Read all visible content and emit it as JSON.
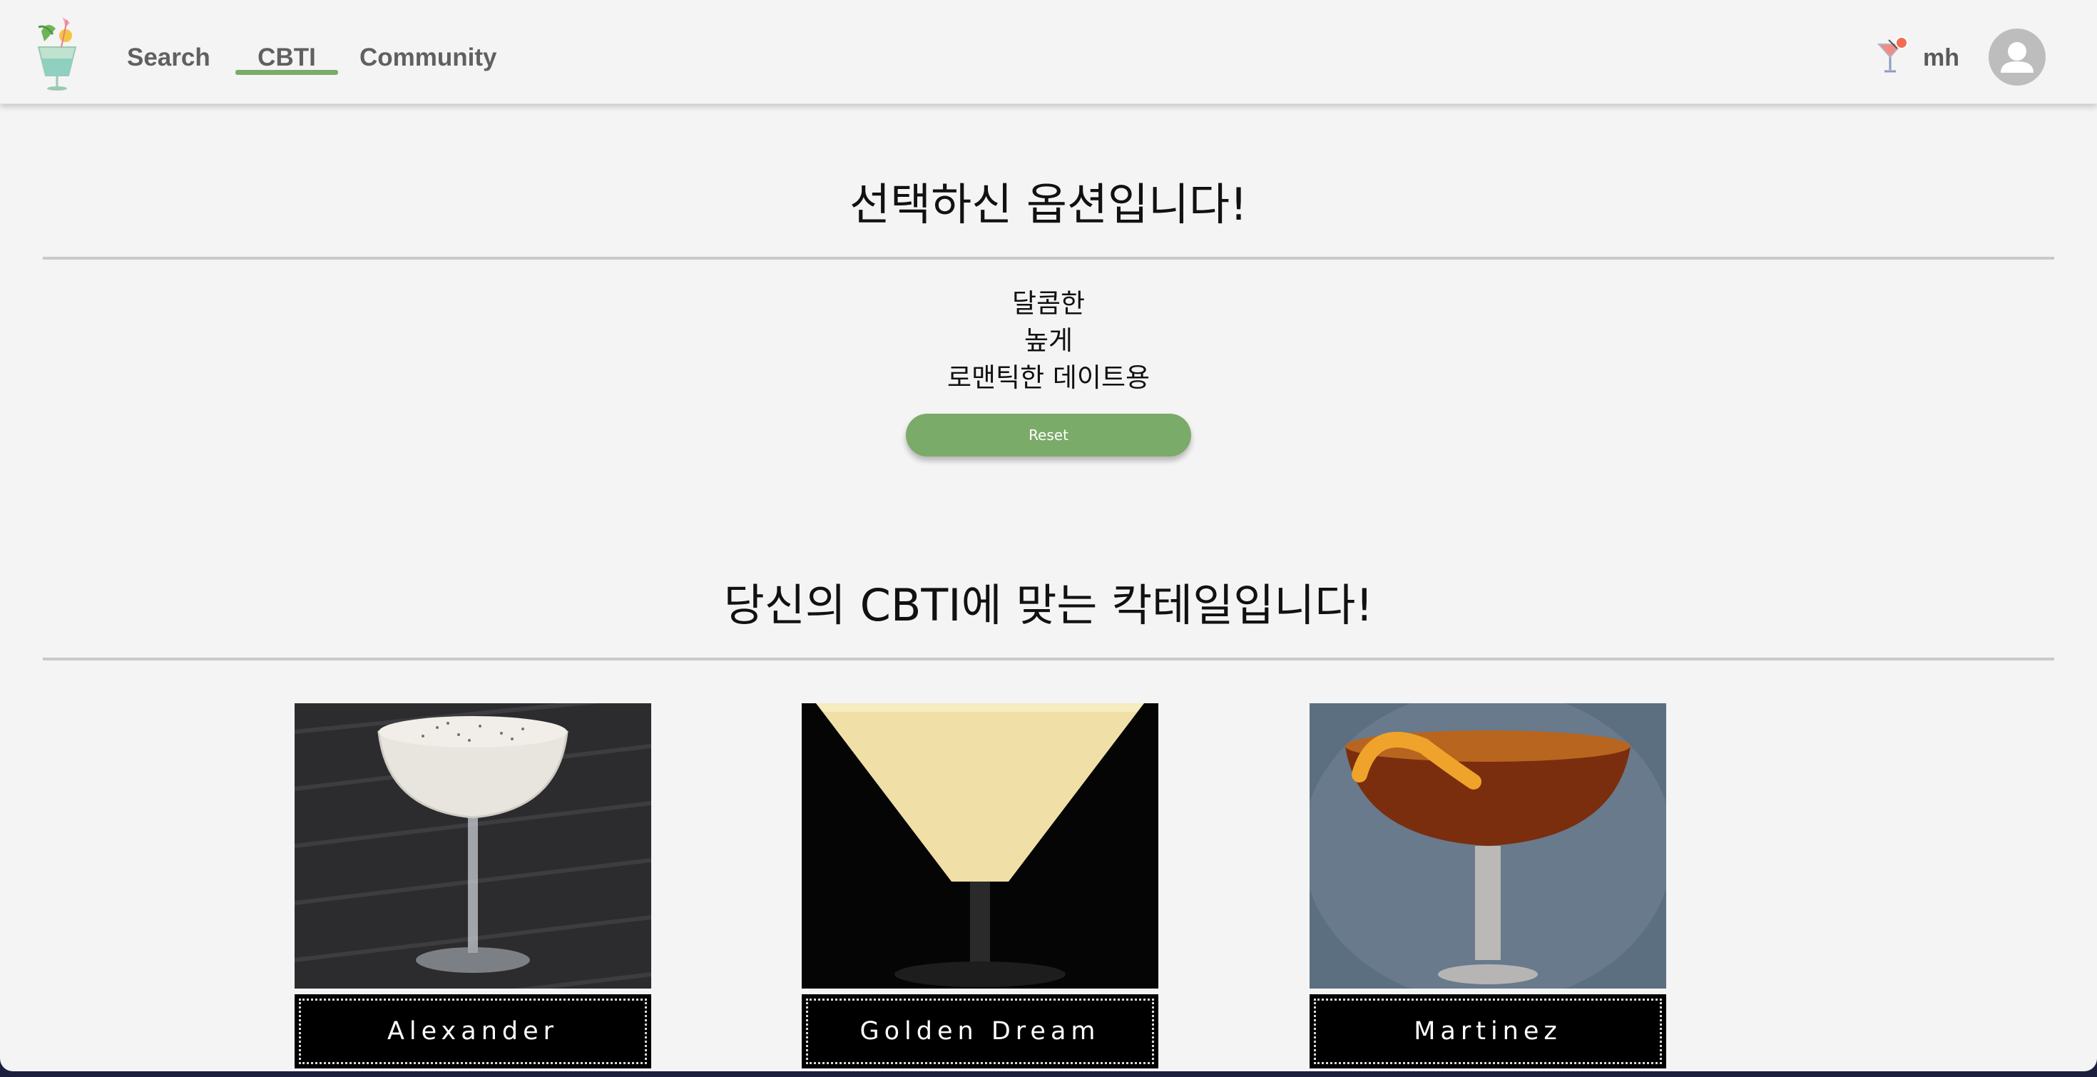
{
  "nav": {
    "search": "Search",
    "cbti": "CBTI",
    "community": "Community",
    "accent_color": "#7aab68"
  },
  "user": {
    "name": "mh",
    "icon": "cocktail-glass-icon"
  },
  "options_section": {
    "title": "선택하신 옵션입니다!",
    "options": [
      "달콤한",
      "높게",
      "로맨틱한 데이트용"
    ],
    "reset_label": "Reset"
  },
  "result_section": {
    "title": "당신의 CBTI에 맞는 칵테일입니다!",
    "cocktails": [
      {
        "name": "Alexander"
      },
      {
        "name": "Golden Dream"
      },
      {
        "name": "Martinez"
      }
    ]
  }
}
